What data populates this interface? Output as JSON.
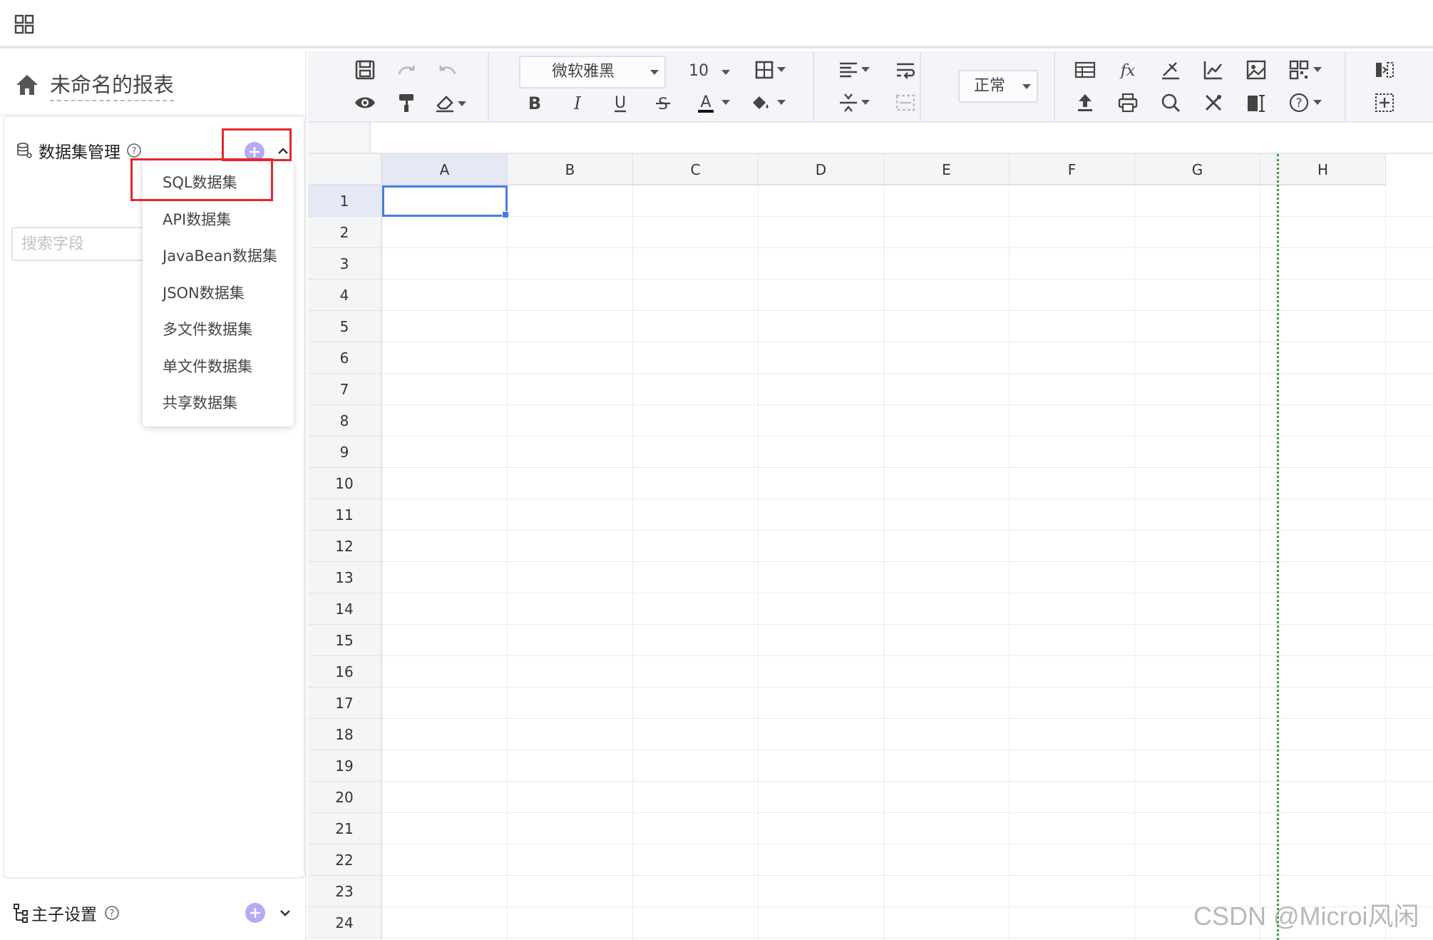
{
  "report": {
    "title": "未命名的报表"
  },
  "dataset_panel": {
    "title": "数据集管理",
    "search_placeholder": "搜索字段",
    "add_icon": "plus-circle-icon",
    "menu_items": [
      "SQL数据集",
      "API数据集",
      "JavaBean数据集",
      "JSON数据集",
      "多文件数据集",
      "单文件数据集",
      "共享数据集"
    ]
  },
  "master_child": {
    "title": "主子设置"
  },
  "toolbar": {
    "font_family": "微软雅黑",
    "font_size": "10",
    "cell_style": "正常"
  },
  "sheet": {
    "columns": [
      "A",
      "B",
      "C",
      "D",
      "E",
      "F",
      "G",
      "H"
    ],
    "rows": [
      "1",
      "2",
      "3",
      "4",
      "5",
      "6",
      "7",
      "8",
      "9",
      "10",
      "11",
      "12",
      "13",
      "14",
      "15",
      "16",
      "17",
      "18",
      "19",
      "20",
      "21",
      "22",
      "23",
      "24"
    ],
    "selected_cell": "A1"
  },
  "watermark": "CSDN @Microi风闲",
  "colors": {
    "accent": "#4a7ce0",
    "add_button": "#b7a9f5",
    "highlight_box": "#e5262b",
    "page_break": "#3a9a3a"
  }
}
